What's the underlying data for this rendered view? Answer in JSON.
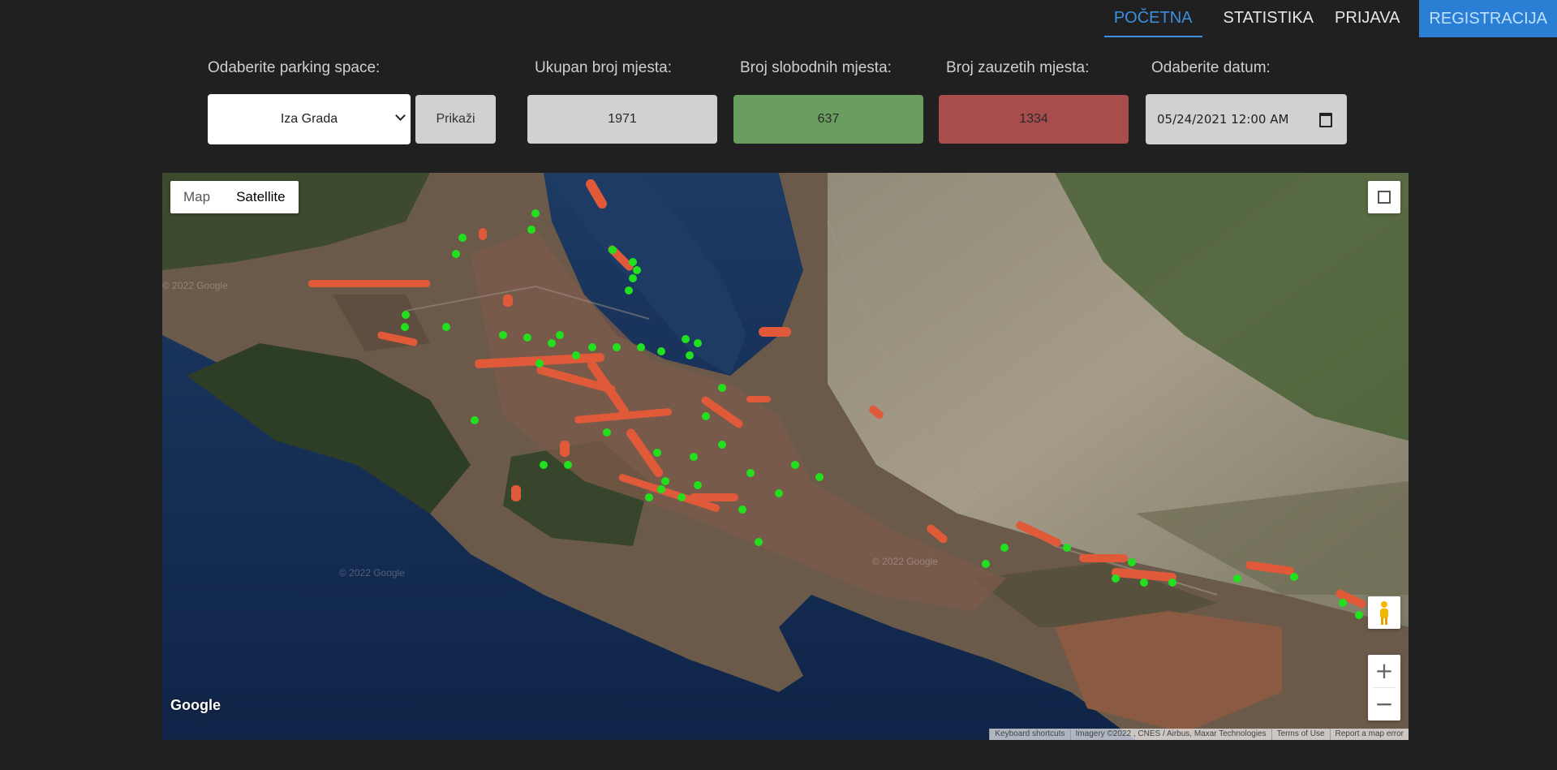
{
  "nav": {
    "items": [
      "POČETNA",
      "STATISTIKA",
      "PRIJAVA"
    ],
    "register": "REGISTRACIJA"
  },
  "controls": {
    "parking_label": "Odaberite parking space:",
    "parking_value": "Iza Grada",
    "show_button": "Prikaži",
    "total_label": "Ukupan broj mjesta:",
    "total_value": "1971",
    "free_label": "Broj slobodnih mjesta:",
    "free_value": "637",
    "occupied_label": "Broj zauzetih mjesta:",
    "occupied_value": "1334",
    "date_label": "Odaberite datum:",
    "date_value": "05/24/2021 12:00  AM"
  },
  "map": {
    "type_map": "Map",
    "type_satellite": "Satellite",
    "logo": "Google",
    "watermark": "© 2022 Google",
    "attribution": [
      "Keyboard shortcuts",
      "Imagery ©2022 , CNES / Airbus, Maxar Technologies",
      "Terms of Use",
      "Report a map error"
    ],
    "zoom_in": "+",
    "zoom_out": "−"
  },
  "colors": {
    "free": "#6a9e5f",
    "occupied": "#a94c4c",
    "accent": "#3d8fe0",
    "marker_free": "#22e01e",
    "marker_occupied": "#e05a3a"
  }
}
